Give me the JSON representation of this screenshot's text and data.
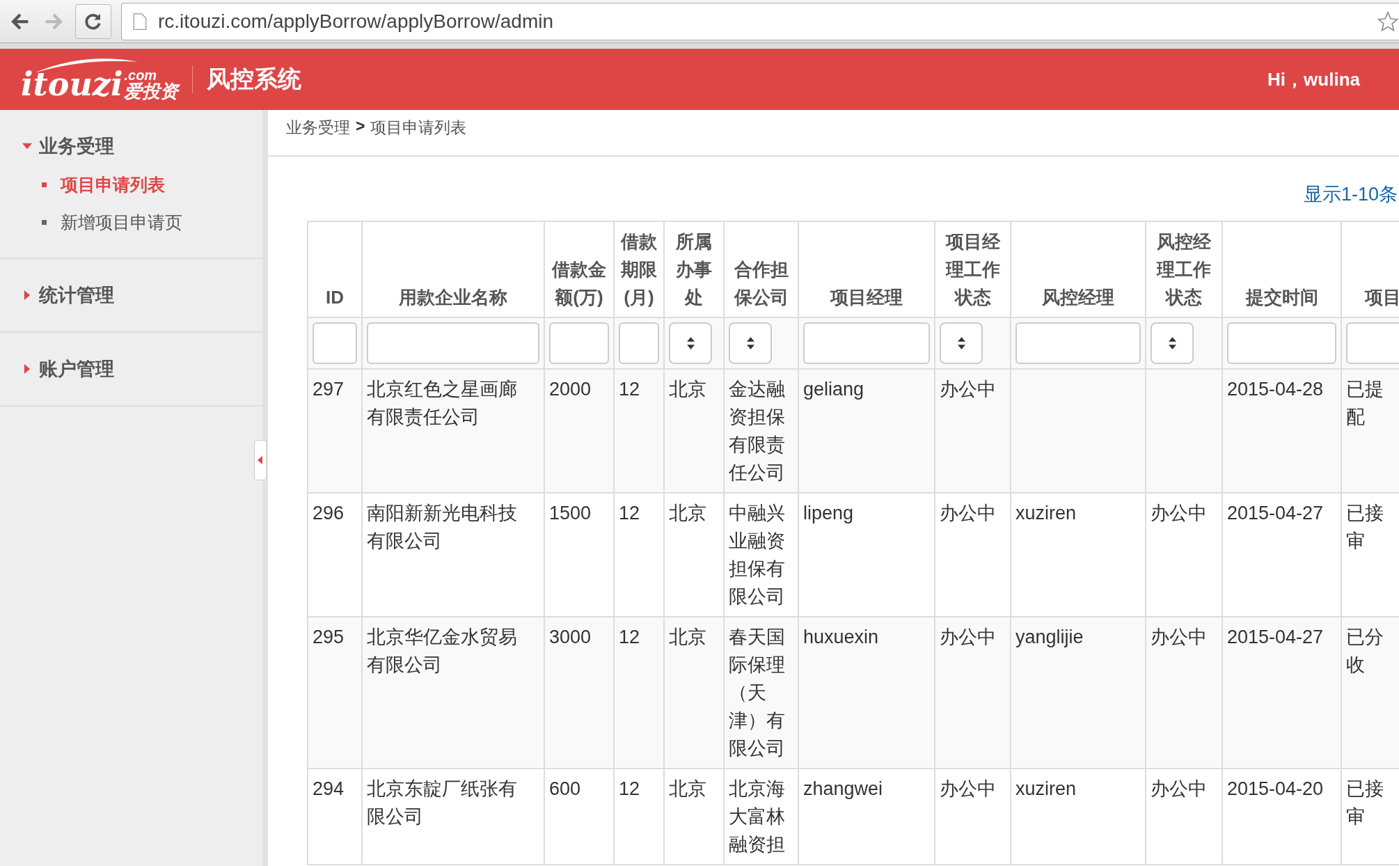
{
  "browser": {
    "url": "rc.itouzi.com/applyBorrow/applyBorrow/admin",
    "forward_disabled": true
  },
  "header": {
    "logo": {
      "word": "itouzi",
      "domain": ".com",
      "cn": "爱投资"
    },
    "system_title": "风控系统",
    "greeting": "Hi，wulina"
  },
  "sidebar": {
    "groups": [
      {
        "label": "业务受理",
        "expanded": true,
        "items": [
          {
            "label": "项目申请列表",
            "selected": true
          },
          {
            "label": "新增项目申请页",
            "selected": false
          }
        ]
      },
      {
        "label": "统计管理",
        "expanded": false
      },
      {
        "label": "账户管理",
        "expanded": false
      }
    ]
  },
  "breadcrumb": {
    "parent": "业务受理",
    "separator": ">",
    "current": "项目申请列表"
  },
  "summary": "显示1-10条",
  "table": {
    "columns": [
      {
        "label": "ID",
        "filter": {
          "kind": "text"
        }
      },
      {
        "label": "用款企业名称",
        "filter": {
          "kind": "text"
        }
      },
      {
        "label": "借款金额(万)",
        "filter": {
          "kind": "text"
        }
      },
      {
        "label": "借款期限(月)",
        "filter": {
          "kind": "text"
        }
      },
      {
        "label": "所属办事处",
        "filter": {
          "kind": "select"
        }
      },
      {
        "label": "合作担保公司",
        "filter": {
          "kind": "select"
        }
      },
      {
        "label": "项目经理",
        "filter": {
          "kind": "text"
        }
      },
      {
        "label": "项目经理工作状态",
        "filter": {
          "kind": "select"
        }
      },
      {
        "label": "风控经理",
        "filter": {
          "kind": "text"
        }
      },
      {
        "label": "风控经理工作状态",
        "filter": {
          "kind": "select"
        }
      },
      {
        "label": "提交时间",
        "filter": {
          "kind": "text"
        }
      },
      {
        "label": "项目",
        "filter": {
          "kind": "text"
        }
      }
    ],
    "rows": [
      {
        "cells": [
          "297",
          "北京红色之星画廊有限责任公司",
          "2000",
          "12",
          "北京",
          "金达融资担保有限责任公司",
          "geliang",
          "办公中",
          "",
          "",
          "2015-04-28",
          [
            "已提",
            "配"
          ]
        ]
      },
      {
        "cells": [
          "296",
          "南阳新新光电科技有限公司",
          "1500",
          "12",
          "北京",
          "中融兴业融资担保有限公司",
          "lipeng",
          "办公中",
          "xuziren",
          "办公中",
          "2015-04-27",
          [
            "已接",
            "审"
          ]
        ]
      },
      {
        "cells": [
          "295",
          "北京华亿金水贸易有限公司",
          "3000",
          "12",
          "北京",
          "春天国际保理（天津）有限公司",
          "huxuexin",
          "办公中",
          "yanglijie",
          "办公中",
          "2015-04-27",
          [
            "已分",
            "收"
          ]
        ]
      },
      {
        "cells": [
          "294",
          "北京东靛厂纸张有限公司",
          "600",
          "12",
          "北京",
          "北京海大富林融资担",
          "zhangwei",
          "办公中",
          "xuziren",
          "办公中",
          "2015-04-20",
          [
            "已接",
            "审"
          ]
        ]
      }
    ]
  }
}
